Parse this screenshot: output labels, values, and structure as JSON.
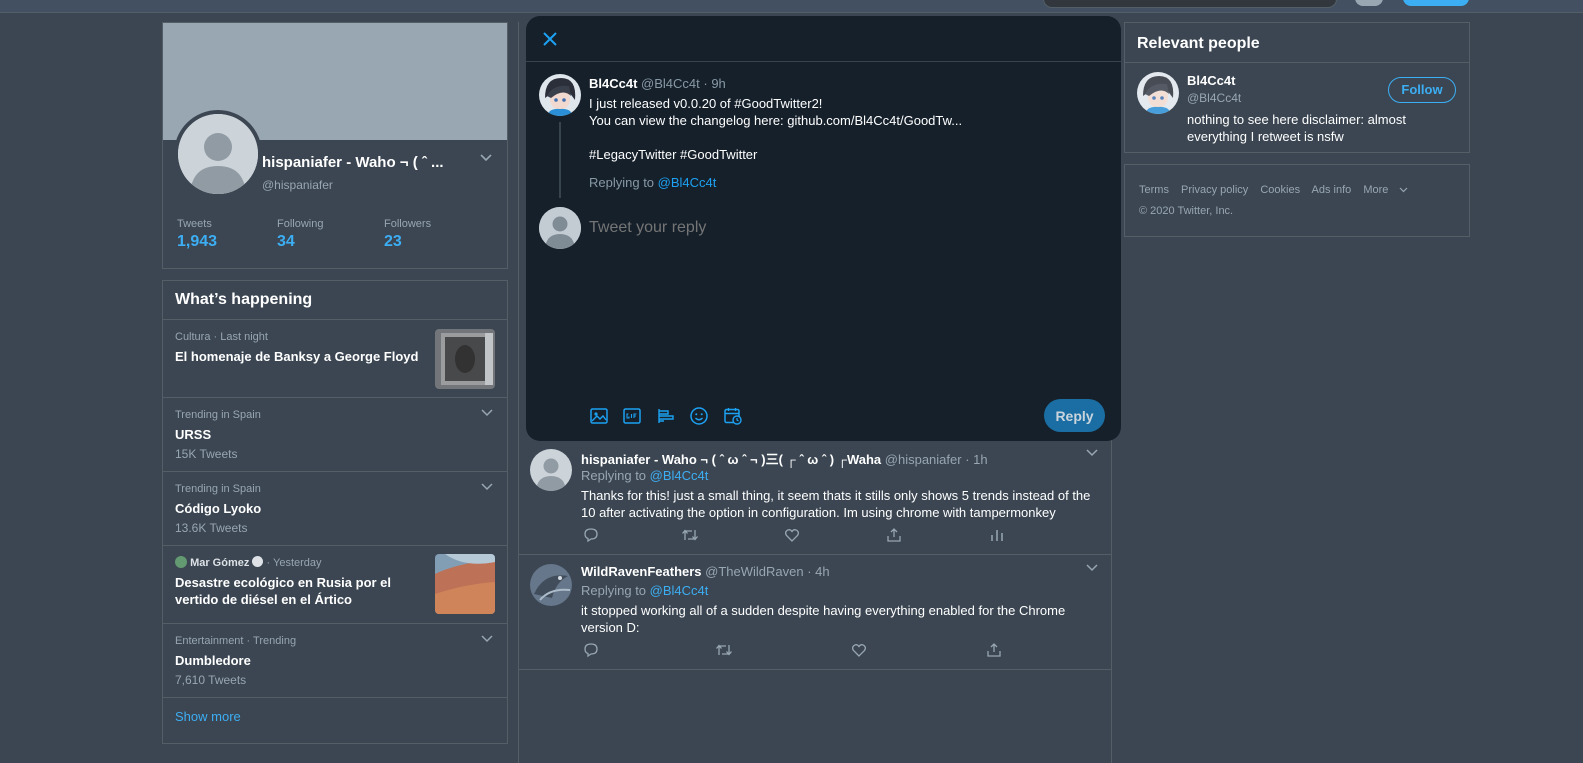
{
  "colors": {
    "accent": "#1da1f2",
    "background": "#15202b",
    "card": "#1b2836",
    "border": "#38444d",
    "muted": "#8899a6"
  },
  "profile": {
    "name": "hispaniafer - Waho ¬ ( ˆ ...",
    "handle": "@hispaniafer",
    "stats": [
      {
        "label": "Tweets",
        "value": "1,943"
      },
      {
        "label": "Following",
        "value": "34"
      },
      {
        "label": "Followers",
        "value": "23"
      }
    ]
  },
  "trends": {
    "title": "What’s happening",
    "items": [
      {
        "meta": "Cultura · Last night",
        "title": "El homenaje de Banksy a George Floyd",
        "count": "",
        "has_thumb": true
      },
      {
        "meta": "Trending in Spain",
        "title": "URSS",
        "count": "15K Tweets"
      },
      {
        "meta": "Trending in Spain",
        "title": "Código Lyoko",
        "count": "13.6K Tweets"
      },
      {
        "meta_author": "Mar Gómez",
        "meta_time": "· Yesterday",
        "title_line1": "Desastre ecológico en Rusia por el",
        "title_line2": "vertido de diésel en el Ártico",
        "has_thumb": true
      },
      {
        "meta": "Entertainment · Trending",
        "title": "Dumbledore",
        "count": "7,610 Tweets"
      }
    ],
    "show_more": "Show more"
  },
  "modal": {
    "tweet": {
      "author": "Bl4Cc4t",
      "handle": "@Bl4Cc4t",
      "time": "· 9h",
      "line1": "I just released v0.0.20 of #GoodTwitter2!",
      "line2": "You can view the changelog here: github.com/Bl4Cc4t/GoodTw...",
      "line3": "#LegacyTwitter #GoodTwitter"
    },
    "replying_label": "Replying to",
    "replying_handle": "@Bl4Cc4t",
    "compose_placeholder": "Tweet your reply",
    "tool_icons": [
      "image-icon",
      "gif-icon",
      "poll-icon",
      "emoji-icon",
      "schedule-icon"
    ],
    "reply_button": "Reply"
  },
  "replies": [
    {
      "name": "hispaniafer - Waho ¬ ( ˆ ω ˆ ¬ )三( ┌ ˆ ω ˆ ) ┌Waha",
      "handle": "@hispaniafer",
      "time": "· 1h",
      "replying_label": "Replying to",
      "replying_handle": "@Bl4Cc4t",
      "text": "Thanks for this! just a small thing, it seem thats it stills only shows 5 trends instead of the 10 after activating the option in configuration. Im using chrome with tampermonkey"
    },
    {
      "name": "WildRavenFeathers",
      "handle": "@TheWildRaven",
      "time": "· 4h",
      "replying_label": "Replying to",
      "replying_handle": "@Bl4Cc4t",
      "text": "it stopped working all of a sudden despite having everything enabled for the Chrome version D:"
    }
  ],
  "relevant_people": {
    "title": "Relevant people",
    "person": {
      "name": "Bl4Cc4t",
      "handle": "@Bl4Cc4t",
      "bio": "nothing to see here disclaimer: almost everything I retweet is nsfw",
      "follow_label": "Follow"
    }
  },
  "footer": {
    "links": [
      "Terms",
      "Privacy policy",
      "Cookies",
      "Ads info",
      "More"
    ],
    "copyright": "© 2020 Twitter, Inc."
  }
}
